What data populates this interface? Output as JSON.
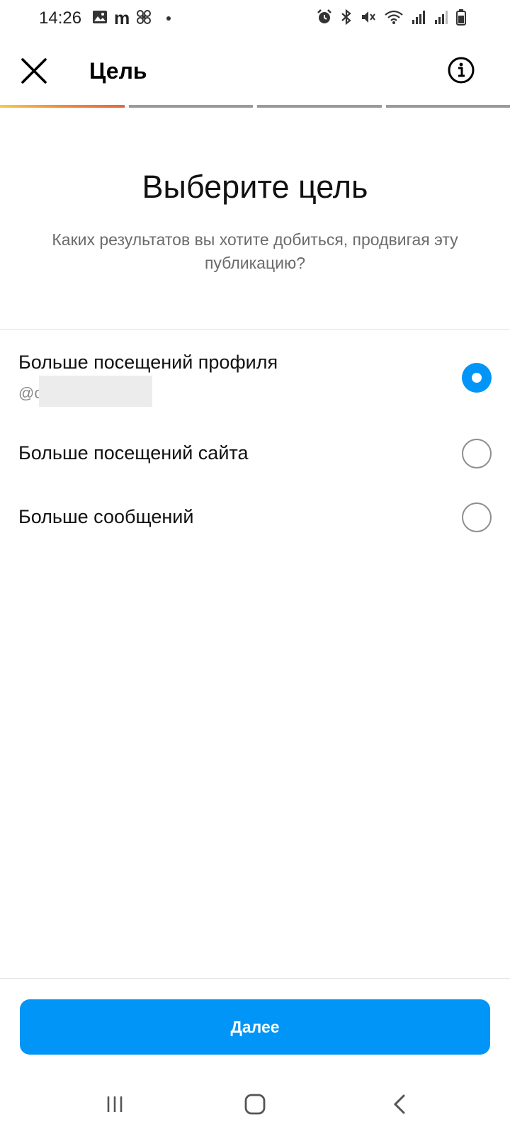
{
  "status_bar": {
    "time": "14:26",
    "left_icons": [
      "gallery-icon",
      "m-app-icon",
      "fan-icon",
      "notification-dot"
    ],
    "m_letter": "m",
    "right_icons": [
      "alarm-icon",
      "bluetooth-icon",
      "mute-icon",
      "wifi-icon",
      "signal-icon",
      "signal-icon-2",
      "battery-icon"
    ]
  },
  "header": {
    "title": "Цель",
    "close_icon": "close-icon",
    "info_icon": "info-icon"
  },
  "progress": {
    "steps_total": 4,
    "current_step": 1,
    "accent_gradient": [
      "#f7c948",
      "#f08a3c",
      "#e6683c"
    ]
  },
  "main": {
    "headline": "Выберите цель",
    "subline": "Каких результатов вы хотите добиться, продвигая эту публикацию?"
  },
  "options": [
    {
      "label": "Больше посещений профиля",
      "sub": "@c",
      "selected": true
    },
    {
      "label": "Больше посещений сайта",
      "selected": false
    },
    {
      "label": "Больше сообщений",
      "selected": false
    }
  ],
  "footer": {
    "next_label": "Далее"
  },
  "colors": {
    "accent": "#0095f6",
    "text_primary": "#111111",
    "text_secondary": "#6b6b6b",
    "divider": "#e4e4e4"
  },
  "nav_bar": {
    "icons": [
      "recents-icon",
      "home-icon",
      "back-icon"
    ]
  }
}
